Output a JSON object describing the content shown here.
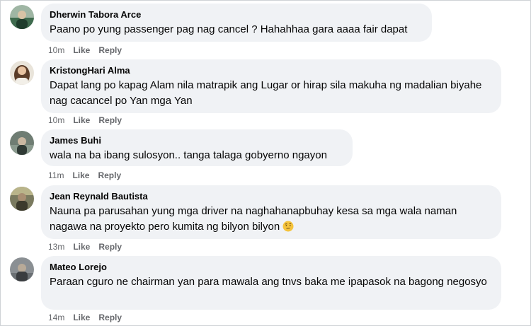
{
  "comments": [
    {
      "author": "Dherwin Tabora Arce",
      "text": "Paano po yung passenger pag nag cancel ? Hahahhaa gara aaaa fair dapat",
      "time": "10m",
      "like_label": "Like",
      "reply_label": "Reply"
    },
    {
      "author": "KristongHari Alma",
      "text": "Dapat lang po kapag Alam nila matrapik ang Lugar or hirap sila makuha ng madalian biyahe nag cacancel po Yan mga Yan",
      "time": "10m",
      "like_label": "Like",
      "reply_label": "Reply"
    },
    {
      "author": "James Buhi",
      "text": "wala na ba ibang sulosyon.. tanga talaga gobyerno ngayon",
      "time": "11m",
      "like_label": "Like",
      "reply_label": "Reply"
    },
    {
      "author": "Jean Reynald Bautista",
      "text": "Nauna pa parusahan yung mga driver na naghahanapbuhay kesa sa mga wala naman nagawa na proyekto pero kumita ng bilyon bilyon",
      "emoji": "face-with-raised-eyebrow-emoji",
      "time": "13m",
      "like_label": "Like",
      "reply_label": "Reply"
    },
    {
      "author": "Mateo Lorejo",
      "text": "Paraan cguro ne chairman yan para mawala ang tnvs baka me ipapasok na bagong negosyo",
      "time": "14m",
      "like_label": "Like",
      "reply_label": "Reply"
    }
  ],
  "colors": {
    "bubble": "#f0f2f5",
    "text": "#050505",
    "meta": "#65676b"
  }
}
